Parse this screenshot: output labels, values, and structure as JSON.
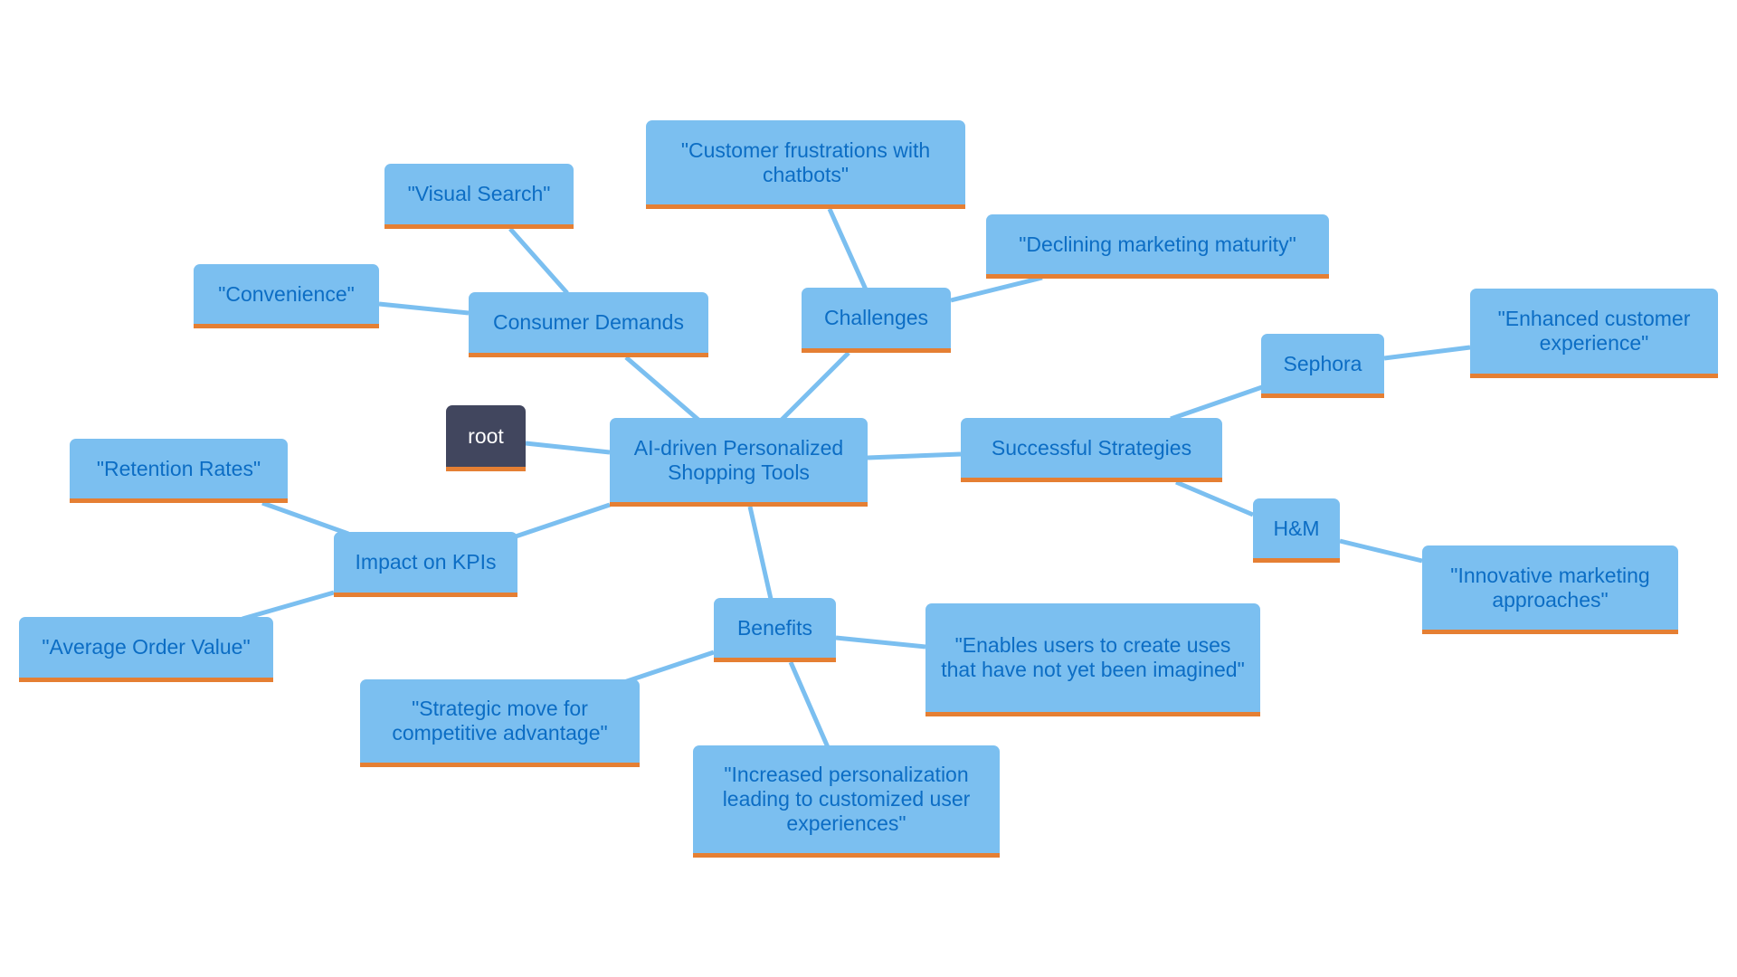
{
  "diagram": {
    "type": "mindmap",
    "colors": {
      "node_fill": "#7bbff0",
      "node_text": "#0c6dc4",
      "node_underline": "#e57f33",
      "root_fill": "#41465e",
      "root_text": "#ffffff",
      "edge": "#7bbff0",
      "background": "#ffffff"
    },
    "nodes": {
      "root": "root",
      "central": "AI-driven Personalized Shopping Tools",
      "consumer_demands": "Consumer Demands",
      "visual_search": "\"Visual Search\"",
      "convenience": "\"Convenience\"",
      "challenges": "Challenges",
      "customer_frustrations": "\"Customer frustrations with chatbots\"",
      "declining_maturity": "\"Declining marketing maturity\"",
      "successful_strategies": "Successful Strategies",
      "sephora": "Sephora",
      "enhanced_experience": "\"Enhanced customer experience\"",
      "hm": "H&M",
      "innovative_marketing": "\"Innovative marketing approaches\"",
      "impact_kpis": "Impact on KPIs",
      "retention_rates": "\"Retention Rates\"",
      "average_order_value": "\"Average Order Value\"",
      "benefits": "Benefits",
      "enables_users": "\"Enables users to create uses that have not yet been imagined\"",
      "strategic_move": "\"Strategic move for competitive advantage\"",
      "increased_personalization": "\"Increased personalization leading to customized user experiences\""
    },
    "edges": [
      [
        "root",
        "central"
      ],
      [
        "central",
        "consumer_demands"
      ],
      [
        "consumer_demands",
        "visual_search"
      ],
      [
        "consumer_demands",
        "convenience"
      ],
      [
        "central",
        "challenges"
      ],
      [
        "challenges",
        "customer_frustrations"
      ],
      [
        "challenges",
        "declining_maturity"
      ],
      [
        "central",
        "successful_strategies"
      ],
      [
        "successful_strategies",
        "sephora"
      ],
      [
        "sephora",
        "enhanced_experience"
      ],
      [
        "successful_strategies",
        "hm"
      ],
      [
        "hm",
        "innovative_marketing"
      ],
      [
        "central",
        "impact_kpis"
      ],
      [
        "impact_kpis",
        "retention_rates"
      ],
      [
        "impact_kpis",
        "average_order_value"
      ],
      [
        "central",
        "benefits"
      ],
      [
        "benefits",
        "enables_users"
      ],
      [
        "benefits",
        "strategic_move"
      ],
      [
        "benefits",
        "increased_personalization"
      ]
    ]
  }
}
